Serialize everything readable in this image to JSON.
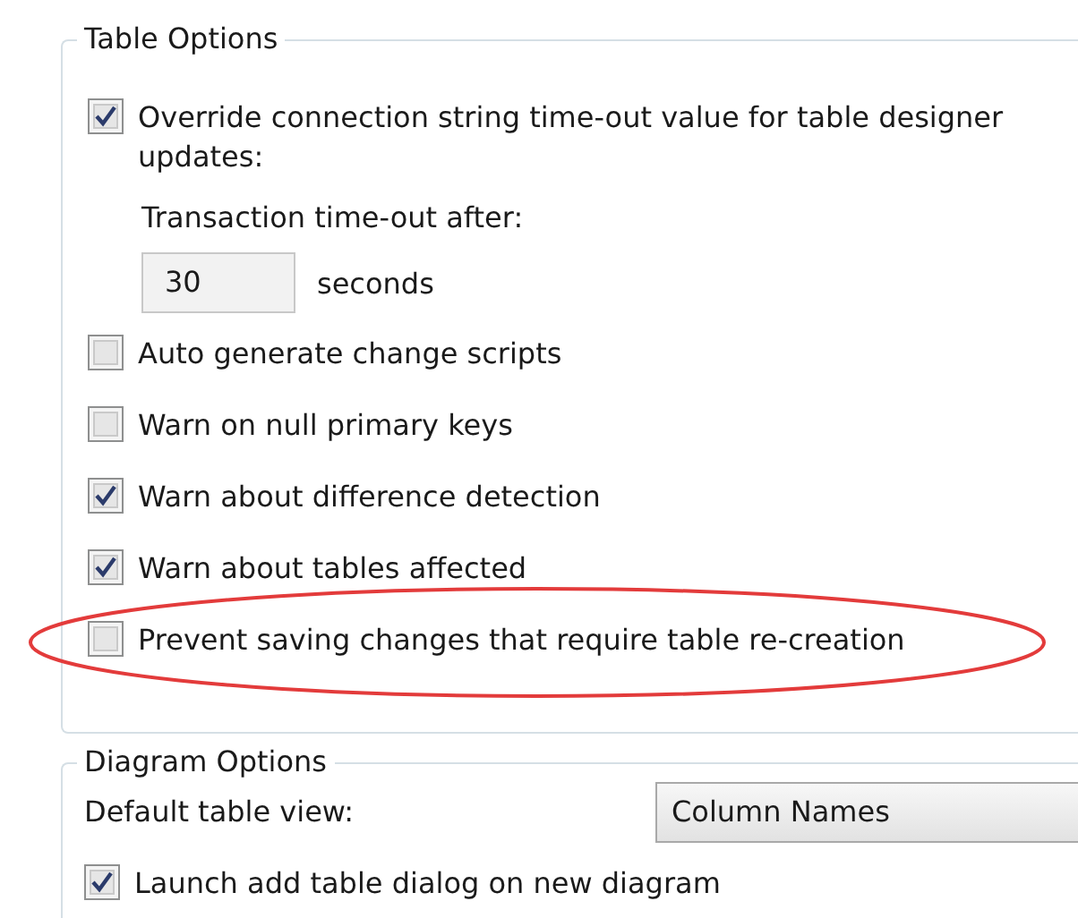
{
  "table_options": {
    "title": "Table Options",
    "options": [
      {
        "kind": "checkbox",
        "label": "Override connection string time-out value for table designer updates:",
        "checked": true,
        "highlighted": false
      },
      {
        "kind": "timeout",
        "label": "Transaction time-out after:",
        "value": "30",
        "unit": "seconds"
      },
      {
        "kind": "checkbox",
        "label": "Auto generate change scripts",
        "checked": false,
        "highlighted": false
      },
      {
        "kind": "checkbox",
        "label": "Warn on null primary keys",
        "checked": false,
        "highlighted": false
      },
      {
        "kind": "checkbox",
        "label": "Warn about difference detection",
        "checked": true,
        "highlighted": false
      },
      {
        "kind": "checkbox",
        "label": "Warn about tables affected",
        "checked": true,
        "highlighted": false
      },
      {
        "kind": "checkbox",
        "label": "Prevent saving changes that require table re-creation",
        "checked": false,
        "highlighted": true
      }
    ]
  },
  "diagram_options": {
    "title": "Diagram Options",
    "default_view_label": "Default table view:",
    "default_view": "Column Names",
    "options": [
      {
        "kind": "checkbox",
        "label": "Launch add table dialog on new diagram",
        "checked": true,
        "highlighted": false
      }
    ]
  }
}
